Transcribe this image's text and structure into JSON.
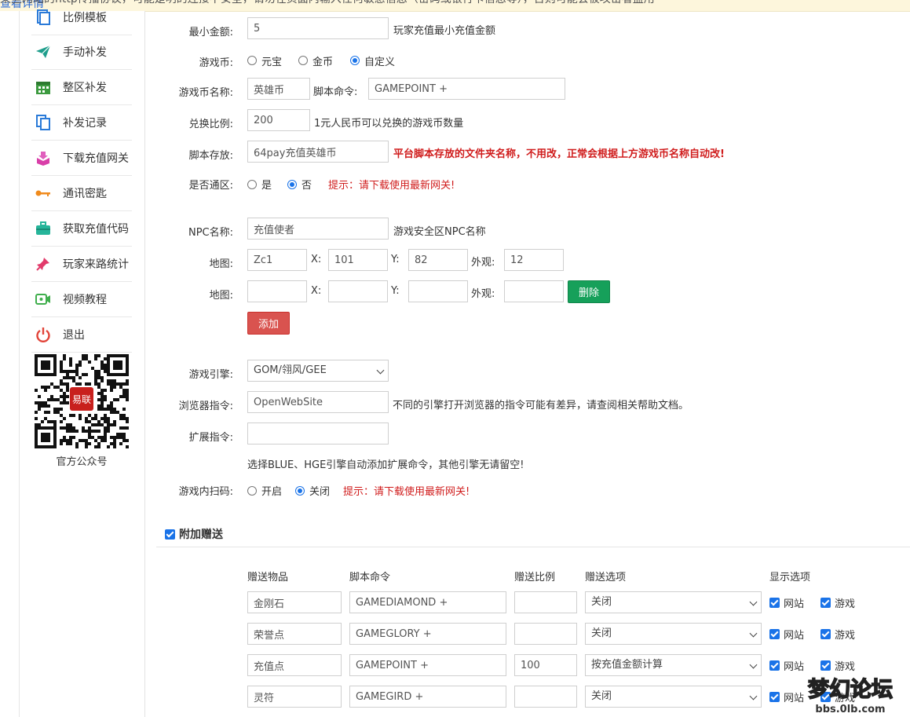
{
  "notice": {
    "text": "某些网站的http传播协议，可能是明的连接不安全，请勿在页面内输入任何敏感信息（密码或银行卡信息等），否则可能会被攻击者盗用",
    "link": "查看详情"
  },
  "sidebar": {
    "items": [
      {
        "label": "比例模板",
        "icon": "document-icon"
      },
      {
        "label": "手动补发",
        "icon": "send-icon"
      },
      {
        "label": "整区补发",
        "icon": "calendar-icon"
      },
      {
        "label": "补发记录",
        "icon": "copy-icon"
      },
      {
        "label": "下载充值网关",
        "icon": "download-box-icon"
      },
      {
        "label": "通讯密匙",
        "icon": "key-icon"
      },
      {
        "label": "获取充值代码",
        "icon": "toolbox-icon"
      },
      {
        "label": "玩家来路统计",
        "icon": "pin-icon"
      },
      {
        "label": "视频教程",
        "icon": "video-icon"
      },
      {
        "label": "退出",
        "icon": "power-icon"
      }
    ],
    "qr_caption": "官方公众号",
    "qr_badge": "易联"
  },
  "form": {
    "min_amount": {
      "label": "最小金额:",
      "value": "5",
      "hint": "玩家充值最小充值金额"
    },
    "currency": {
      "label": "游戏币:",
      "options": [
        "元宝",
        "金币",
        "自定义"
      ],
      "selected": "自定义"
    },
    "currency_name": {
      "label": "游戏币名称:",
      "value": "英雄币",
      "script_label": "脚本命令:",
      "script_value": "GAMEPOINT +"
    },
    "ratio": {
      "label": "兑换比例:",
      "value": "200",
      "hint": "1元人民币可以兑换的游戏币数量"
    },
    "script_dir": {
      "label": "脚本存放:",
      "value": "64pay充值英雄币",
      "hint": "平台脚本存放的文件夹名称，不用改，正常会根据上方游戏币名称自动改!"
    },
    "all_zones": {
      "label": "是否通区:",
      "options": [
        "是",
        "否"
      ],
      "selected": "否",
      "hint": "提示：请下载使用最新网关!"
    },
    "npc_name": {
      "label": "NPC名称:",
      "value": "充值使者",
      "hint": "游戏安全区NPC名称"
    },
    "map_rows": [
      {
        "label": "地图:",
        "map": "Zc1",
        "x_label": "X:",
        "x": "101",
        "y_label": "Y:",
        "y": "82",
        "look_label": "外观:",
        "look": "12"
      },
      {
        "label": "地图:",
        "map": "",
        "x_label": "X:",
        "x": "",
        "y_label": "Y:",
        "y": "",
        "look_label": "外观:",
        "look": ""
      }
    ],
    "delete_button": "删除",
    "add_button": "添加",
    "engine": {
      "label": "游戏引擎:",
      "value": "GOM/翎风/GEE"
    },
    "browser_cmd": {
      "label": "浏览器指令:",
      "value": "OpenWebSite",
      "hint": "不同的引擎打开浏览器的指令可能有差异，请查阅相关帮助文档。"
    },
    "ext_cmd": {
      "label": "扩展指令:",
      "value": "",
      "hint": "选择BLUE、HGE引擎自动添加扩展命令，其他引擎无请留空!"
    },
    "in_game_scan": {
      "label": "游戏内扫码:",
      "options": [
        "开启",
        "关闭"
      ],
      "selected": "关闭",
      "hint": "提示：请下载使用最新网关!"
    }
  },
  "bonus": {
    "title": "附加赠送",
    "checked": true,
    "headers": [
      "赠送物品",
      "脚本命令",
      "赠送比例",
      "赠送选项",
      "显示选项"
    ],
    "display_labels": [
      "网站",
      "游戏"
    ],
    "rows": [
      {
        "item": "金刚石",
        "cmd": "GAMEDIAMOND +",
        "ratio": "",
        "option": "关闭"
      },
      {
        "item": "荣誉点",
        "cmd": "GAMEGLORY +",
        "ratio": "",
        "option": "关闭"
      },
      {
        "item": "充值点",
        "cmd": "GAMEPOINT +",
        "ratio": "100",
        "option": "按充值金额计算"
      },
      {
        "item": "灵符",
        "cmd": "GAMEGIRD +",
        "ratio": "",
        "option": "关闭"
      }
    ]
  },
  "watermark": {
    "text": "梦幻论坛",
    "sub": "bbs.0lb.com"
  }
}
